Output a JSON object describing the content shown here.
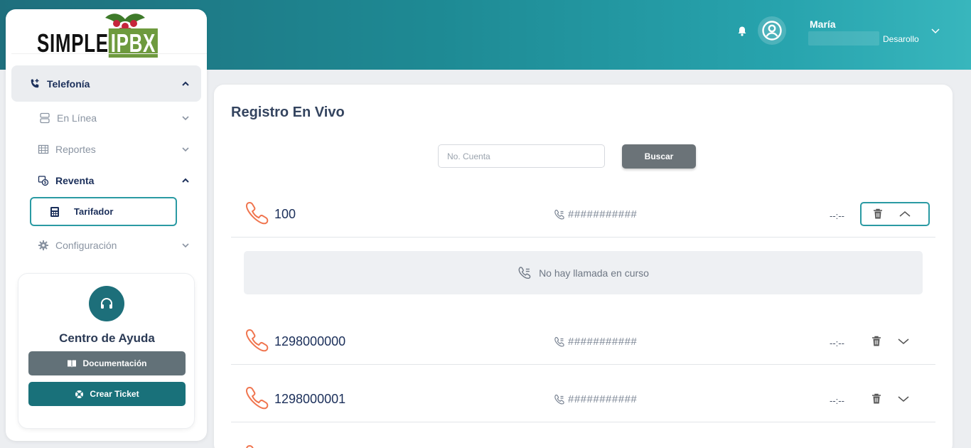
{
  "brand": {
    "logo_text_left": "SIMPLE",
    "logo_text_right": "IPBX"
  },
  "header": {
    "user_name": "María",
    "user_role": "Desarollo"
  },
  "sidebar": {
    "items": [
      {
        "label": "Telefonía"
      },
      {
        "label": "En Línea"
      },
      {
        "label": "Reportes"
      },
      {
        "label": "Reventa"
      },
      {
        "label": "Tarifador"
      },
      {
        "label": "Configuración"
      }
    ],
    "help": {
      "title": "Centro de Ayuda",
      "doc_label": "Documentación",
      "ticket_label": "Crear Ticket"
    }
  },
  "main": {
    "title": "Registro En Vivo",
    "search": {
      "placeholder": "No. Cuenta",
      "button_label": "Buscar"
    },
    "empty_message": "No hay llamada en curso",
    "rows": [
      {
        "number": "100",
        "masked": "###########",
        "time": "--:--"
      },
      {
        "number": "1298000000",
        "masked": "###########",
        "time": "--:--"
      },
      {
        "number": "1298000001",
        "masked": "###########",
        "time": "--:--"
      }
    ]
  },
  "colors": {
    "accent": "#2a9aa3",
    "phone_icon": "#f0754f",
    "nav_text": "#1b2f5a"
  }
}
